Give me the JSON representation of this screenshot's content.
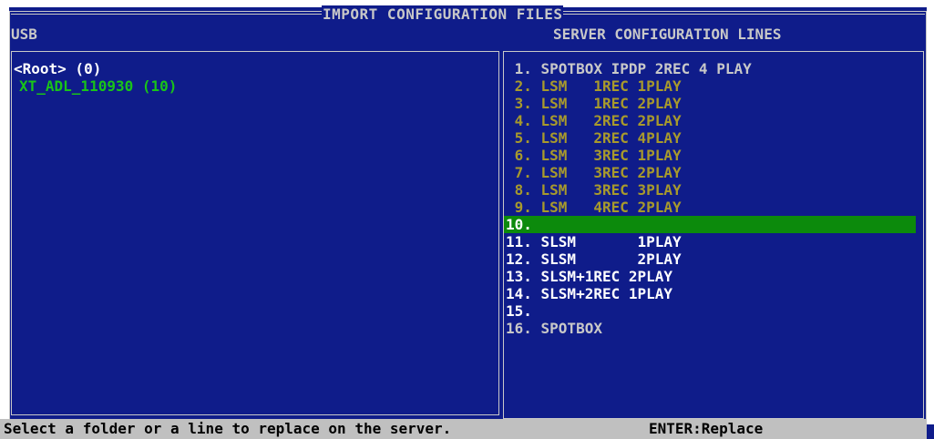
{
  "window": {
    "title": "IMPORT CONFIGURATION FILES"
  },
  "usb_panel": {
    "header": "USB",
    "folders": [
      {
        "label": "<Root> (0)",
        "color": "#ffffff",
        "indent": false
      },
      {
        "label": "XT_ADL_110930 (10)",
        "color": "#19c419",
        "indent": true
      }
    ]
  },
  "server_panel": {
    "header": "SERVER CONFIGURATION LINES",
    "selected_index": 9,
    "lines": [
      {
        "text": " 1. SPOTBOX IPDP 2REC 4 PLAY",
        "color": "#c8c8c8"
      },
      {
        "text": " 2. LSM   1REC 1PLAY",
        "color": "#a89a2c"
      },
      {
        "text": " 3. LSM   1REC 2PLAY",
        "color": "#a89a2c"
      },
      {
        "text": " 4. LSM   2REC 2PLAY",
        "color": "#a89a2c"
      },
      {
        "text": " 5. LSM   2REC 4PLAY",
        "color": "#a89a2c"
      },
      {
        "text": " 6. LSM   3REC 1PLAY",
        "color": "#a89a2c"
      },
      {
        "text": " 7. LSM   3REC 2PLAY",
        "color": "#a89a2c"
      },
      {
        "text": " 8. LSM   3REC 3PLAY",
        "color": "#a89a2c"
      },
      {
        "text": " 9. LSM   4REC 2PLAY",
        "color": "#a89a2c"
      },
      {
        "text": "10.",
        "color": "#ffffff"
      },
      {
        "text": "11. SLSM       1PLAY",
        "color": "#ffffff"
      },
      {
        "text": "12. SLSM       2PLAY",
        "color": "#ffffff"
      },
      {
        "text": "13. SLSM+1REC 2PLAY",
        "color": "#ffffff"
      },
      {
        "text": "14. SLSM+2REC 1PLAY",
        "color": "#ffffff"
      },
      {
        "text": "15.",
        "color": "#ffffff"
      },
      {
        "text": "16. SPOTBOX",
        "color": "#c8c8c8"
      }
    ]
  },
  "status_bar": {
    "message": "Select a folder or a line to replace on the server.",
    "key_hint": "ENTER:Replace"
  },
  "colors": {
    "background": "#0f1c8a",
    "border": "#c8c8c8",
    "selection": "#0c8a0c",
    "status_bar": "#c0c0c0"
  }
}
